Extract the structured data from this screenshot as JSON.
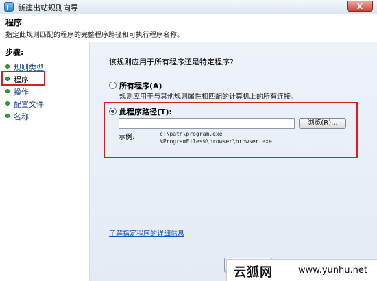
{
  "window": {
    "title": "新建出站规则向导",
    "close_glyph": "X"
  },
  "header": {
    "title": "程序",
    "subtitle": "指定此规则匹配的程序的完整程序路径和可执行程序名称。"
  },
  "sidebar": {
    "steps_label": "步骤:",
    "items": [
      {
        "label": "规则类型"
      },
      {
        "label": "程序"
      },
      {
        "label": "操作"
      },
      {
        "label": "配置文件"
      },
      {
        "label": "名称"
      }
    ]
  },
  "main": {
    "question": "该规则应用于所有程序还是特定程序?",
    "all_programs": {
      "label": "所有程序(A)",
      "description": "规则应用于与其他规则属性相匹配的计算机上的所有连接。",
      "selected": false
    },
    "this_program": {
      "label": "此程序路径(T):",
      "selected": true,
      "path_value": "",
      "browse_label": "浏览(R)...",
      "example_label": "示例:",
      "examples": [
        "c:\\path\\program.exe",
        "%ProgramFiles%\\browser\\browser.exe"
      ]
    },
    "learn_more": "了解指定程序的详细信息"
  },
  "watermark": {
    "brand": "云狐网",
    "url": "www.yunhu.net"
  },
  "colors": {
    "highlight": "#d62020",
    "link": "#1a4fbf",
    "step_dot": "#2fa52f"
  }
}
